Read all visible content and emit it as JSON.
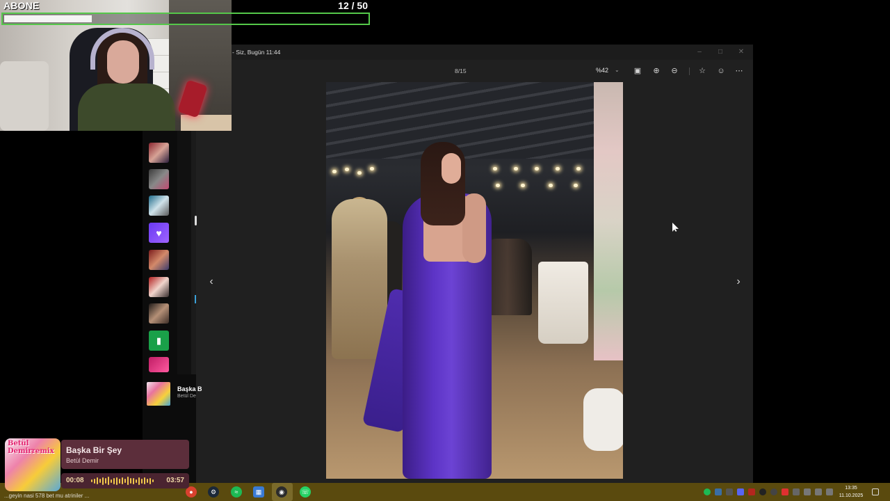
{
  "overlay": {
    "goal_label": "ABONE",
    "goal_count": "12  / 50",
    "goal_progress": 0.24
  },
  "viewer": {
    "title": "- Siz, Bugün 11:44",
    "counter": "8/15",
    "zoom": "%42",
    "toolbar_icons": [
      "fit-icon",
      "zoom-in-icon",
      "zoom-out-icon",
      "favorite-icon",
      "emoji-icon",
      "more-icon"
    ]
  },
  "music_app": {
    "now_title": "Başka B",
    "now_artist": "Betül De"
  },
  "now_playing": {
    "cover_text": "Betül Demirremix",
    "song": "Başka Bir Şey",
    "artist": "Betül Demir",
    "elapsed": "00:08",
    "duration": "03:57"
  },
  "taskbar": {
    "ticker": "...geyin nasi 578 bet mu atriniler ...",
    "clock_time": "13:35",
    "clock_date": "11.10.2025",
    "apps": [
      "chrome-icon",
      "steam-icon",
      "spotify-icon",
      "store-icon",
      "obs-icon",
      "whatsapp-icon"
    ]
  }
}
